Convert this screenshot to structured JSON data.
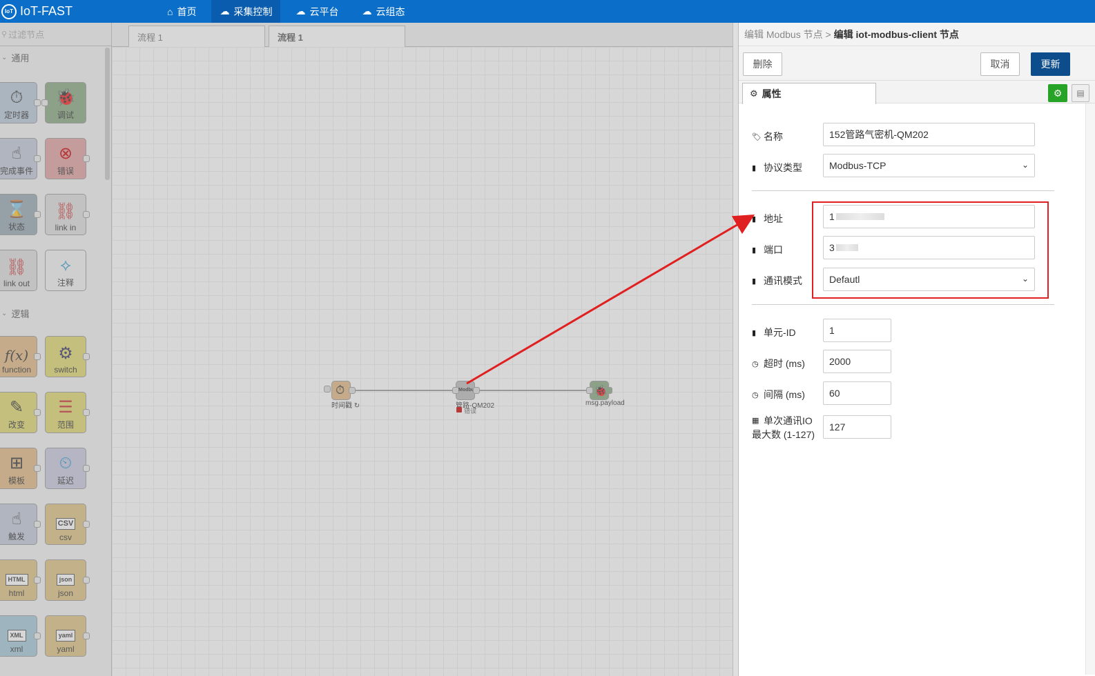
{
  "app": {
    "logo_badge": "IoT",
    "title": "IoT-FAST"
  },
  "nav": [
    {
      "label": "首页",
      "icon": "home-icon"
    },
    {
      "label": "采集控制",
      "icon": "cloud-gear-icon"
    },
    {
      "label": "云平台",
      "icon": "cloud-platform-icon"
    },
    {
      "label": "云组态",
      "icon": "cloud-config-icon"
    }
  ],
  "palette": {
    "filter_placeholder": "过滤节点",
    "categories": {
      "common": "通用",
      "logic": "逻辑"
    },
    "nodes": {
      "timer": "定时器",
      "debug": "调试",
      "complete": "完成事件",
      "error": "错误",
      "status": "状态",
      "link_in": "link in",
      "link_out": "link out",
      "comment": "注释",
      "function": "function",
      "switch": "switch",
      "change": "改变",
      "range": "范围",
      "template": "模板",
      "delay": "延迟",
      "trigger": "触发",
      "csv": "csv",
      "html": "html",
      "json": "json",
      "xml": "xml",
      "yaml": "yaml"
    },
    "icon_text": {
      "fx": "f(x)",
      "csv": "CSV",
      "html": "HTML",
      "json": "json",
      "xml": "XML",
      "yaml": "yaml"
    }
  },
  "tabs": [
    {
      "label": "流程 1"
    },
    {
      "label": "流程 1"
    }
  ],
  "flow": {
    "node1": "时间戳 ↻",
    "node2": "管路-QM202",
    "node2_status": "错误",
    "node3": "msg.payload"
  },
  "panel": {
    "crumb_prefix": "编辑 Modbus 节点 >",
    "crumb_title": "编辑 iot-modbus-client 节点",
    "delete_label": "删除",
    "cancel_label": "取消",
    "update_label": "更新",
    "tab_label": "属性",
    "fields": {
      "name_label": "名称",
      "name_value": "152管路气密机-QM202",
      "protocol_label": "协议类型",
      "protocol_value": "Modbus-TCP",
      "address_label": "地址",
      "address_value": "1",
      "port_label": "端口",
      "port_value": "3",
      "mode_label": "通讯模式",
      "mode_value": "Defautl",
      "unit_label": "单元-ID",
      "unit_value": "1",
      "timeout_label": "超时 (ms)",
      "timeout_value": "2000",
      "interval_label": "间隔 (ms)",
      "interval_value": "60",
      "maxio_label_1": "单次通讯IO",
      "maxio_label_2": "最大数 (1-127)",
      "maxio_value": "127"
    }
  },
  "colors": {
    "header": "#0b6fc9",
    "primary_button": "#0d4d8c",
    "highlight": "#e02020",
    "gear_button": "#27a327"
  }
}
